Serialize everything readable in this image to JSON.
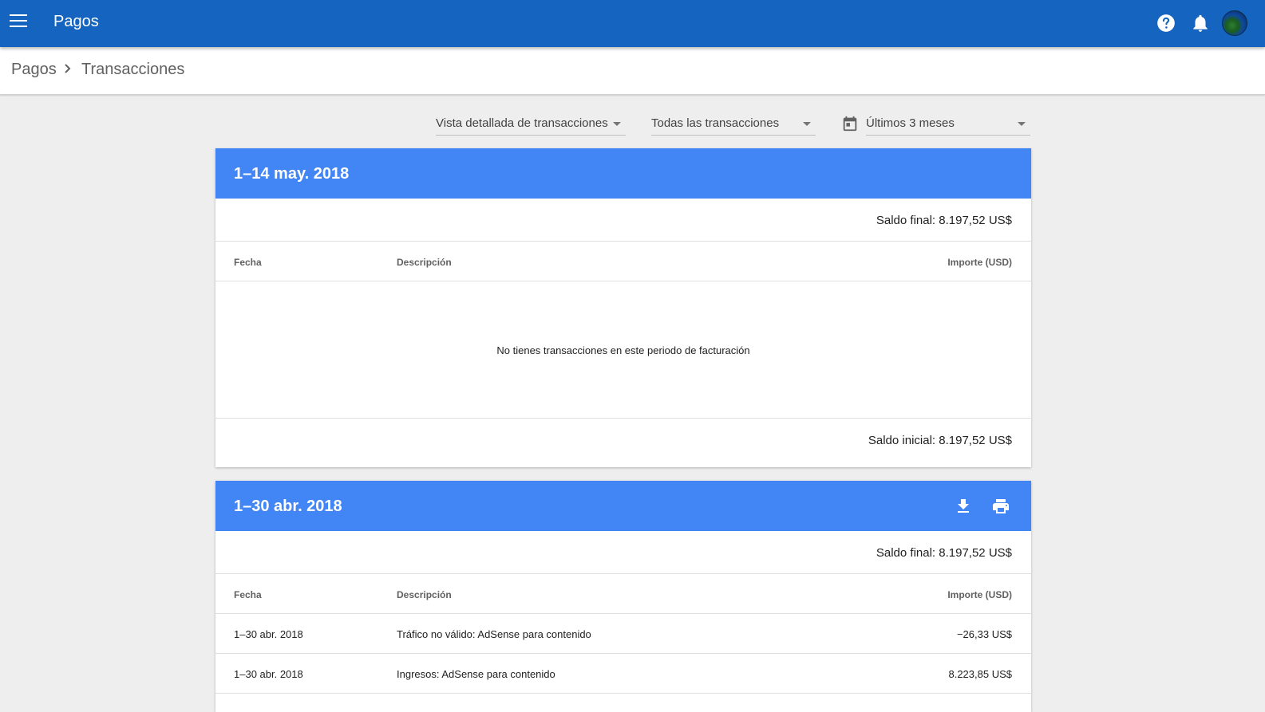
{
  "header": {
    "title": "Pagos",
    "icons": [
      "menu-icon",
      "help-icon",
      "notifications-icon",
      "avatar"
    ]
  },
  "breadcrumb": {
    "root": "Pagos",
    "current": "Transacciones"
  },
  "filters": {
    "view": "Vista detallada de transacciones",
    "type": "Todas las transacciones",
    "range": "Últimos 3 meses"
  },
  "periods": [
    {
      "title": "1–14 may. 2018",
      "final_balance": "Saldo final: 8.197,52 US$",
      "columns": {
        "date": "Fecha",
        "description": "Descripción",
        "amount": "Importe (USD)"
      },
      "empty_message": "No tienes transacciones en este periodo de facturación",
      "initial_balance": "Saldo inicial: 8.197,52 US$"
    },
    {
      "title": "1–30 abr. 2018",
      "final_balance": "Saldo final: 8.197,52 US$",
      "columns": {
        "date": "Fecha",
        "description": "Descripción",
        "amount": "Importe (USD)"
      },
      "rows": [
        {
          "date": "1–30 abr. 2018",
          "description": "Tráfico no válido: AdSense para contenido",
          "amount": "−26,33 US$"
        },
        {
          "date": "1–30 abr. 2018",
          "description": "Ingresos: AdSense para contenido",
          "amount": "8.223,85 US$"
        }
      ]
    }
  ],
  "colors": {
    "topbar": "#1565c0",
    "card_header": "#4285f4",
    "background": "#eeeeee"
  }
}
